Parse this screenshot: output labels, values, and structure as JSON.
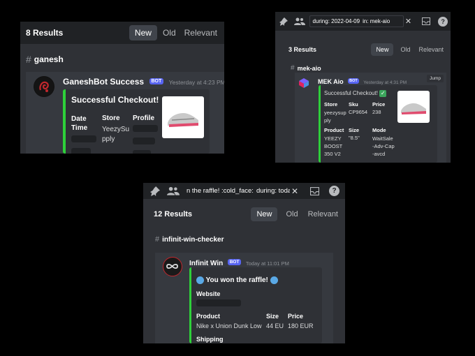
{
  "panel1": {
    "results": "8 Results",
    "tabs": [
      "New",
      "Old",
      "Relevant"
    ],
    "channel": "ganesh",
    "user": "GaneshBot Success",
    "bot": "BOT",
    "timestamp": "Yesterday at 4:23 PM",
    "embed_title": "Successful Checkout!",
    "fields": [
      {
        "label": "Date Time",
        "value": ""
      },
      {
        "label": "Store",
        "value": "YeezySupply"
      },
      {
        "label": "Profile",
        "value": ""
      }
    ]
  },
  "panel2": {
    "search_terms": [
      "during: 2022-04-09",
      "in: mek-aio"
    ],
    "results": "3 Results",
    "tabs": [
      "New",
      "Old",
      "Relevant"
    ],
    "channel": "mek-aio",
    "user": "MEK Aio",
    "bot": "BOT",
    "timestamp": "Yesterday at 4:31 PM",
    "jump": "Jump",
    "embed_title": "Successful Checkout!",
    "fields_row1": [
      {
        "label": "Store",
        "value": "yeezysupply"
      },
      {
        "label": "Sku",
        "value": "CP9654"
      },
      {
        "label": "Price",
        "value": "238"
      }
    ],
    "fields_row2": [
      {
        "label": "Product",
        "value": "YEEZY BOOST 350 V2"
      },
      {
        "label": "Size",
        "value": "\"8.5\""
      },
      {
        "label": "Mode",
        "value": "WaitSale-Adv-Cap-avcd"
      }
    ]
  },
  "panel3": {
    "search_terms": [
      "n the raffle! :cold_face:",
      "during: today"
    ],
    "results": "12 Results",
    "tabs": [
      "New",
      "Old",
      "Relevant"
    ],
    "channel": "infinit-win-checker",
    "user": "Infinit Win",
    "bot": "BOT",
    "timestamp": "Today at 11:01 PM",
    "embed_title": "You won the raffle!",
    "website_label": "Website",
    "product_label": "Product",
    "product_value": "Nike x Union Dunk Low",
    "size_label": "Size",
    "size_value": "44 EU",
    "price_label": "Price",
    "price_value": "180 EUR",
    "shipping_label": "Shipping"
  },
  "colors": {
    "accent": "#5865f2",
    "embed_bar": "#2ed03a",
    "bg": "#2f3136"
  },
  "icons": [
    "pin-icon",
    "members-icon",
    "close-icon",
    "inbox-icon",
    "help-icon",
    "checkmark-icon",
    "cold-face-icon"
  ]
}
